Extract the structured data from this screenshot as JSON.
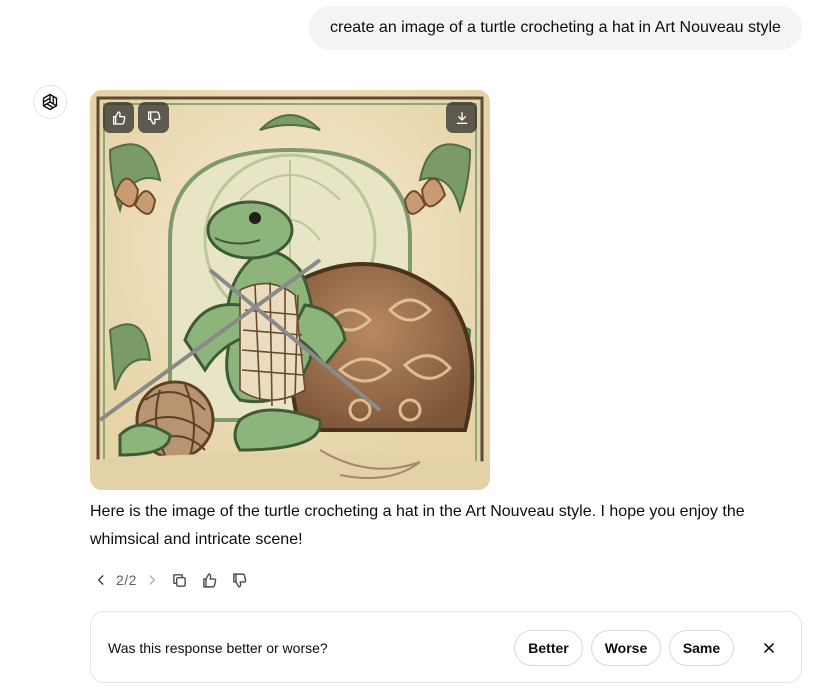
{
  "user_message": {
    "text": "create an image of a turtle crocheting a hat in Art Nouveau style"
  },
  "assistant": {
    "avatar_icon": "openai-logo-icon",
    "image": {
      "alt": "Art Nouveau turtle crocheting",
      "overlay_buttons": [
        "thumbs-up-icon",
        "thumbs-down-icon",
        "download-icon"
      ]
    },
    "response_text": "Here is the image of the turtle crocheting a hat in the Art Nouveau style. I hope you enjoy the whimsical and intricate scene!",
    "pager": "2/2",
    "action_icons": [
      "chevron-left-icon",
      "chevron-right-icon",
      "copy-icon",
      "thumbs-up-icon",
      "thumbs-down-icon"
    ]
  },
  "feedback": {
    "question": "Was this response better or worse?",
    "better_label": "Better",
    "worse_label": "Worse",
    "same_label": "Same",
    "close_icon": "close-icon"
  },
  "colors": {
    "bubble_bg": "#f4f4f4",
    "text": "#0d0d0d",
    "muted": "#5d5d5d",
    "border": "#e3e3e3"
  }
}
